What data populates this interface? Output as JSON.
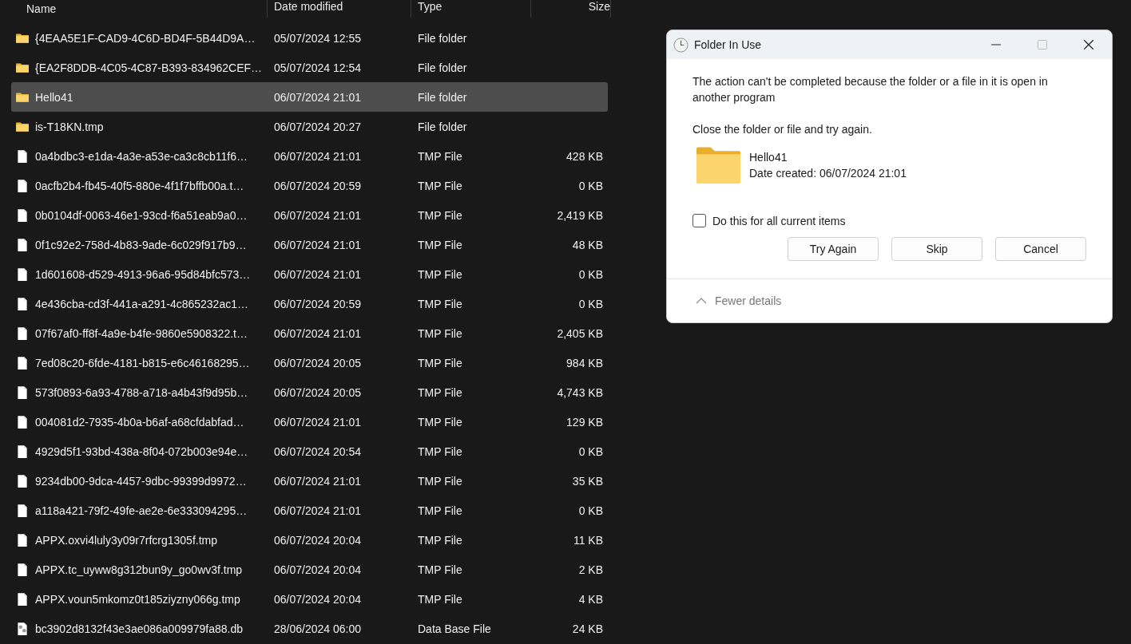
{
  "explorer": {
    "columns": [
      "Name",
      "Date modified",
      "Type",
      "Size"
    ],
    "rows": [
      {
        "kind": "folder",
        "name": "{4EAA5E1F-CAD9-4C6D-BD4F-5B44D9A…",
        "date": "05/07/2024 12:55",
        "type": "File folder",
        "selected": false
      },
      {
        "kind": "folder",
        "name": "{EA2F8DDB-4C05-4C87-B393-834962CEF…",
        "date": "05/07/2024 12:54",
        "type": "File folder",
        "selected": false
      },
      {
        "kind": "folder",
        "name": "Hello41",
        "date": "06/07/2024 21:01",
        "type": "File folder",
        "selected": true
      },
      {
        "kind": "folder",
        "name": "is-T18KN.tmp",
        "date": "06/07/2024 20:27",
        "type": "File folder",
        "selected": false
      },
      {
        "kind": "file",
        "name": "0a4bdbc3-e1da-4a3e-a53e-ca3c8cb11f6…",
        "date": "06/07/2024 21:01",
        "type": "TMP File",
        "size": "428 KB",
        "selected": false
      },
      {
        "kind": "file",
        "name": "0acfb2b4-fb45-40f5-880e-4f1f7bffb00a.t…",
        "date": "06/07/2024 20:59",
        "type": "TMP File",
        "size": "0 KB",
        "selected": false
      },
      {
        "kind": "file",
        "name": "0b0104df-0063-46e1-93cd-f6a51eab9a0…",
        "date": "06/07/2024 21:01",
        "type": "TMP File",
        "size": "2,419 KB",
        "selected": false
      },
      {
        "kind": "file",
        "name": "0f1c92e2-758d-4b83-9ade-6c029f917b9…",
        "date": "06/07/2024 21:01",
        "type": "TMP File",
        "size": "48 KB",
        "selected": false
      },
      {
        "kind": "file",
        "name": "1d601608-d529-4913-96a6-95d84bfc573…",
        "date": "06/07/2024 21:01",
        "type": "TMP File",
        "size": "0 KB",
        "selected": false
      },
      {
        "kind": "file",
        "name": "4e436cba-cd3f-441a-a291-4c865232ac1…",
        "date": "06/07/2024 20:59",
        "type": "TMP File",
        "size": "0 KB",
        "selected": false
      },
      {
        "kind": "file",
        "name": "07f67af0-ff8f-4a9e-b4fe-9860e5908322.t…",
        "date": "06/07/2024 21:01",
        "type": "TMP File",
        "size": "2,405 KB",
        "selected": false
      },
      {
        "kind": "file",
        "name": "7ed08c20-6fde-4181-b815-e6c46168295…",
        "date": "06/07/2024 20:05",
        "type": "TMP File",
        "size": "984 KB",
        "selected": false
      },
      {
        "kind": "file",
        "name": "573f0893-6a93-4788-a718-a4b43f9d95b…",
        "date": "06/07/2024 20:05",
        "type": "TMP File",
        "size": "4,743 KB",
        "selected": false
      },
      {
        "kind": "file",
        "name": "004081d2-7935-4b0a-b6af-a68cfdabfad…",
        "date": "06/07/2024 21:01",
        "type": "TMP File",
        "size": "129 KB",
        "selected": false
      },
      {
        "kind": "file",
        "name": "4929d5f1-93bd-438a-8f04-072b003e94e…",
        "date": "06/07/2024 20:54",
        "type": "TMP File",
        "size": "0 KB",
        "selected": false
      },
      {
        "kind": "file",
        "name": "9234db00-9dca-4457-9dbc-99399d9972…",
        "date": "06/07/2024 21:01",
        "type": "TMP File",
        "size": "35 KB",
        "selected": false
      },
      {
        "kind": "file",
        "name": "a118a421-79f2-49fe-ae2e-6e333094295…",
        "date": "06/07/2024 21:01",
        "type": "TMP File",
        "size": "0 KB",
        "selected": false
      },
      {
        "kind": "file",
        "name": "APPX.oxvi4luly3y09r7rfcrg1305f.tmp",
        "date": "06/07/2024 20:04",
        "type": "TMP File",
        "size": "11 KB",
        "selected": false
      },
      {
        "kind": "file",
        "name": "APPX.tc_uyww8g312bun9y_go0wv3f.tmp",
        "date": "06/07/2024 20:04",
        "type": "TMP File",
        "size": "2 KB",
        "selected": false
      },
      {
        "kind": "file",
        "name": "APPX.voun5mkomz0t185ziyzny066g.tmp",
        "date": "06/07/2024 20:04",
        "type": "TMP File",
        "size": "4 KB",
        "selected": false
      },
      {
        "kind": "db",
        "name": "bc3902d8132f43e3ae086a009979fa88.db",
        "date": "28/06/2024 06:00",
        "type": "Data Base File",
        "size": "24 KB",
        "selected": false
      }
    ]
  },
  "dialog": {
    "title": "Folder In Use",
    "message": "The action can't be completed because the folder or a file in it is open in another program",
    "instruction": "Close the folder or file and try again.",
    "item": {
      "name": "Hello41",
      "date_created": "Date created: 06/07/2024 21:01"
    },
    "checkbox": {
      "label": "Do this for all current items",
      "checked": false
    },
    "buttons": [
      "Try Again",
      "Skip",
      "Cancel"
    ],
    "details_toggle": "Fewer details"
  }
}
